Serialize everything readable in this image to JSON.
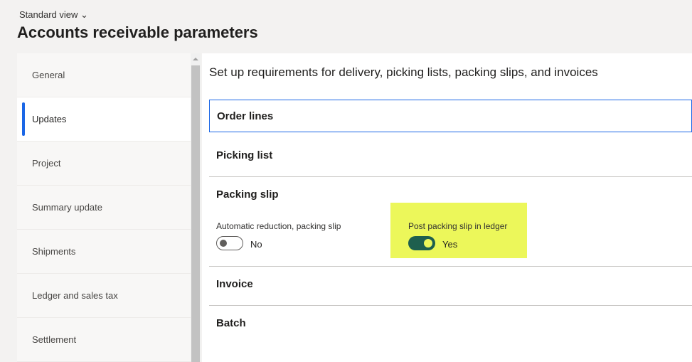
{
  "header": {
    "view_label": "Standard view",
    "page_title": "Accounts receivable parameters"
  },
  "nav": {
    "items": [
      {
        "label": "General"
      },
      {
        "label": "Updates"
      },
      {
        "label": "Project"
      },
      {
        "label": "Summary update"
      },
      {
        "label": "Shipments"
      },
      {
        "label": "Ledger and sales tax"
      },
      {
        "label": "Settlement"
      }
    ],
    "active": "Updates"
  },
  "main": {
    "subtitle": "Set up requirements for delivery, picking lists, packing slips, and invoices",
    "sections": {
      "order_lines": "Order lines",
      "picking_list": "Picking list",
      "packing_slip": "Packing slip",
      "invoice": "Invoice",
      "batch": "Batch"
    },
    "fields": {
      "auto_reduction": {
        "label": "Automatic reduction, packing slip",
        "value": "No"
      },
      "post_ledger": {
        "label": "Post packing slip in ledger",
        "value": "Yes"
      }
    }
  },
  "colors": {
    "accent": "#1a66e6",
    "toggle_on": "#1e5f4e",
    "highlight": "#ecf75a"
  }
}
